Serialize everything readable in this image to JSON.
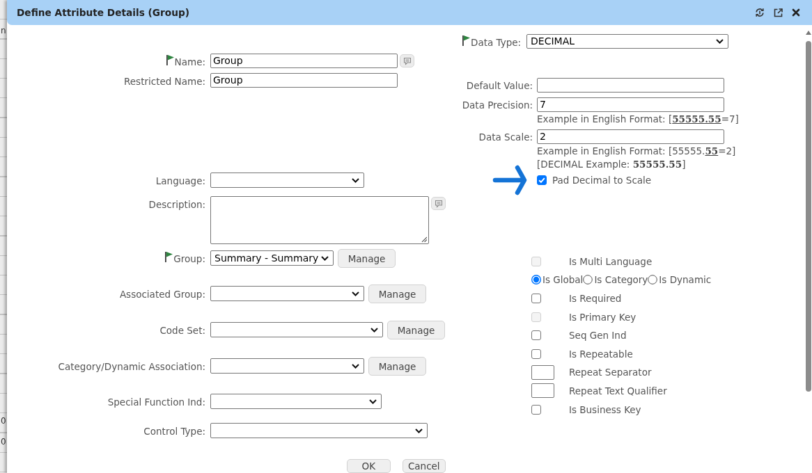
{
  "window": {
    "title": "Define Attribute Details (Group)"
  },
  "background_grid": {
    "cells": [
      "n",
      "0",
      "0"
    ]
  },
  "fields": [
    {
      "label": "Name:",
      "kind": "text",
      "value": "Group",
      "required": true,
      "comment": true
    },
    {
      "label": "Restricted Name:",
      "kind": "text",
      "value": "Group",
      "required": false,
      "comment": false
    },
    {
      "label": "Language:",
      "kind": "select",
      "required": false,
      "comment": false
    },
    {
      "label": "Description:",
      "kind": "textarea",
      "required": false,
      "comment": true
    },
    {
      "label": "Group:",
      "kind": "select",
      "value": "Summary - Summary",
      "required": true,
      "comment": false,
      "action": "Manage"
    },
    {
      "label": "Associated Group:",
      "kind": "select",
      "required": false,
      "comment": false,
      "action": "Manage"
    },
    {
      "label": "Code Set:",
      "kind": "select",
      "required": false,
      "comment": false,
      "action": "Manage"
    },
    {
      "label": "Category/Dynamic Association:",
      "kind": "select",
      "required": false,
      "comment": false,
      "action": "Manage"
    },
    {
      "label": "Special Function Ind:",
      "kind": "select",
      "required": false,
      "comment": false
    },
    {
      "label": "Control Type:",
      "kind": "select",
      "required": false,
      "comment": false
    }
  ],
  "data_type": {
    "label": "Data Type:",
    "required": true,
    "value": "DECIMAL"
  },
  "numeric": [
    {
      "kind": "field",
      "label": "Default Value:"
    },
    {
      "kind": "field",
      "label": "Data Precision:",
      "value": "7"
    },
    {
      "kind": "hint",
      "text": "Example in English Format: [**55555.55**=7]",
      "underlined": true
    },
    {
      "kind": "field",
      "label": "Data Scale:",
      "value": "2"
    },
    {
      "kind": "hint",
      "text": "Example in English Format: [55555.**55**=2]",
      "underlined": true
    },
    {
      "kind": "hint",
      "text": "[DECIMAL Example: **55555.55**]",
      "underlined": false
    },
    {
      "kind": "checkbox",
      "label": "Pad Decimal to Scale",
      "checked": true
    }
  ],
  "options": [
    {
      "kind": "checkbox",
      "label": "Is Multi Language",
      "checked": false,
      "disabled": true
    },
    {
      "kind": "radio-group",
      "choices": [
        {
          "label": "Is Global",
          "selected": true
        },
        {
          "label": "Is Category",
          "selected": false
        },
        {
          "label": "Is Dynamic",
          "selected": false
        }
      ]
    },
    {
      "kind": "checkbox",
      "label": "Is Required",
      "checked": false,
      "disabled": false
    },
    {
      "kind": "checkbox",
      "label": "Is Primary Key",
      "checked": false,
      "disabled": true
    },
    {
      "kind": "checkbox",
      "label": "Seq Gen Ind",
      "checked": false,
      "disabled": false
    },
    {
      "kind": "checkbox",
      "label": "Is Repeatable",
      "checked": false,
      "disabled": false
    },
    {
      "kind": "text-field",
      "label": "Repeat Separator"
    },
    {
      "kind": "text-field",
      "label": "Repeat Text Qualifier"
    },
    {
      "kind": "checkbox",
      "label": "Is Business Key",
      "checked": false,
      "disabled": false
    }
  ],
  "buttons": [
    "OK",
    "Cancel"
  ]
}
